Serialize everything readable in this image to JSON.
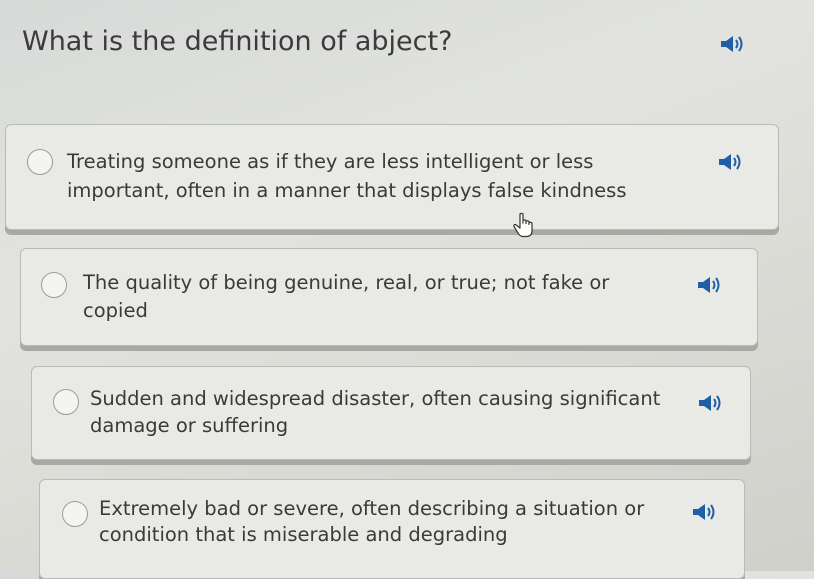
{
  "question": {
    "text": "What is the definition of abject?",
    "speaker_icon": "speaker-icon"
  },
  "options": [
    {
      "text": "Treating someone as if they are less intelligent or less\nimportant, often in a manner that displays false kindness",
      "selected": false
    },
    {
      "text": "The quality of being genuine, real, or true; not fake or\ncopied",
      "selected": false
    },
    {
      "text": "Sudden and widespread disaster, often causing significant\ndamage or suffering",
      "selected": false
    },
    {
      "text": "Extremely bad or severe, often describing a situation or\ncondition that is miserable and degrading",
      "selected": false
    }
  ],
  "colors": {
    "speaker": "#1f5fa8",
    "card_background": "#e9e9e5",
    "card_shadow": "#a7a9a3"
  }
}
